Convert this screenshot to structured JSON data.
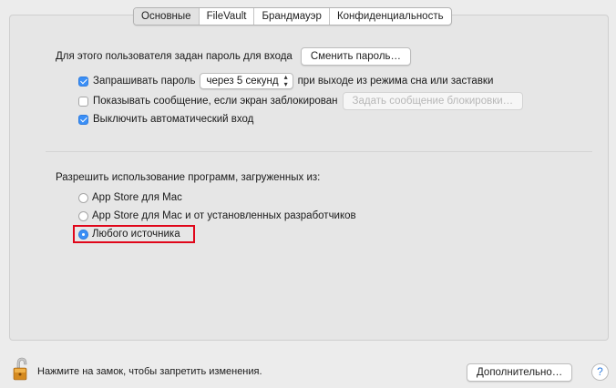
{
  "tabs": [
    {
      "label": "Основные",
      "active": true
    },
    {
      "label": "FileVault",
      "active": false
    },
    {
      "label": "Брандмауэр",
      "active": false
    },
    {
      "label": "Конфиденциальность",
      "active": false
    }
  ],
  "password": {
    "label": "Для этого пользователя задан пароль для входа",
    "change_button": "Сменить пароль…"
  },
  "require_password": {
    "checked": true,
    "label": "Запрашивать пароль",
    "select_value": "через 5 секунд",
    "suffix": "при выходе из режима сна или заставки"
  },
  "show_message": {
    "checked": false,
    "label": "Показывать сообщение, если экран заблокирован",
    "button": "Задать сообщение блокировки…"
  },
  "auto_login": {
    "checked": true,
    "label": "Выключить автоматический вход"
  },
  "allow_apps": {
    "label": "Разрешить использование программ, загруженных из:",
    "options": [
      {
        "label": "App Store для Mac",
        "selected": false
      },
      {
        "label": "App Store для Mac и от установленных разработчиков",
        "selected": false
      },
      {
        "label": "Любого источника",
        "selected": true
      }
    ]
  },
  "footer": {
    "lock_text": "Нажмите на замок, чтобы запретить изменения.",
    "advanced_button": "Дополнительно…",
    "help_label": "?"
  },
  "colors": {
    "accent": "#3b8ff6",
    "highlight": "#e0061a"
  }
}
